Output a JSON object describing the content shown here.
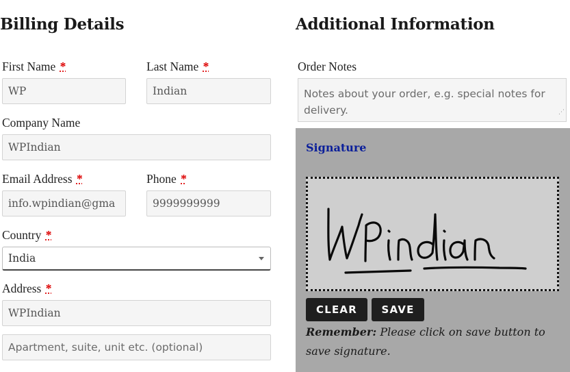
{
  "billing": {
    "heading": "Billing Details",
    "first_name": {
      "label": "First Name",
      "required": "*",
      "value": "WP"
    },
    "last_name": {
      "label": "Last Name",
      "required": "*",
      "value": "Indian"
    },
    "company_name": {
      "label": "Company Name",
      "value": "WPIndian"
    },
    "email": {
      "label": "Email Address",
      "required": "*",
      "value": "info.wpindian@gma"
    },
    "phone": {
      "label": "Phone",
      "required": "*",
      "value": "9999999999"
    },
    "country": {
      "label": "Country",
      "required": "*",
      "value": "India"
    },
    "address": {
      "label": "Address",
      "required": "*",
      "value": "WPIndian",
      "line2_placeholder": "Apartment, suite, unit etc. (optional)"
    }
  },
  "additional": {
    "heading": "Additional Information",
    "order_notes": {
      "label": "Order Notes",
      "placeholder": "Notes about your order, e.g. special notes for delivery."
    }
  },
  "signature": {
    "title": "Signature",
    "handwriting": "WPindian",
    "clear_label": "CLEAR",
    "save_label": "SAVE",
    "remember_bold": "Remember:",
    "remember_text": "Please click on save button to save signature.",
    "panel_color": "#a8a8a8",
    "pad_color": "#cfcfcf"
  }
}
